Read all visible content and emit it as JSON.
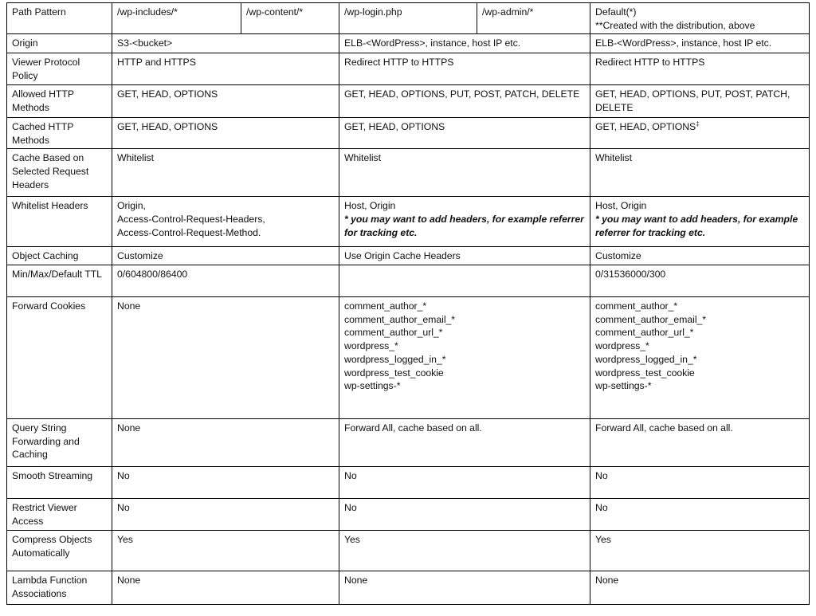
{
  "document": {
    "type": "cloudfront-behaviors-comparison-table",
    "columns": {
      "label_header": "Path Pattern",
      "headers": [
        {
          "id": "wp-includes",
          "label": "/wp-includes/*"
        },
        {
          "id": "wp-content",
          "label": "/wp-content/*"
        },
        {
          "id": "wp-login",
          "label": "/wp-login.php"
        },
        {
          "id": "wp-admin",
          "label": "/wp-admin/*"
        },
        {
          "id": "default",
          "label": "Default(*)",
          "note": "**Created with the distribution, above"
        }
      ]
    },
    "rows": [
      {
        "label": "Origin",
        "group_static": [
          "S3-<bucket>"
        ],
        "group_login": [
          "ELB-<WordPress>, instance, host IP etc."
        ],
        "group_default": [
          "ELB-<WordPress>, instance, host IP etc."
        ]
      },
      {
        "label": "Viewer Protocol Policy",
        "group_static": [
          "HTTP and HTTPS"
        ],
        "group_login": [
          "Redirect HTTP to HTTPS"
        ],
        "group_default": [
          "Redirect HTTP to HTTPS"
        ]
      },
      {
        "label": "Allowed HTTP Methods",
        "group_static": [
          "GET, HEAD, OPTIONS"
        ],
        "group_login": [
          "GET, HEAD, OPTIONS, PUT, POST, PATCH, DELETE"
        ],
        "group_default": [
          "GET, HEAD, OPTIONS, PUT, POST, PATCH, DELETE"
        ]
      },
      {
        "label": "Cached HTTP Methods",
        "group_static": [
          "GET, HEAD, OPTIONS"
        ],
        "group_login": [
          "GET, HEAD, OPTIONS"
        ],
        "group_default": [
          "GET, HEAD, OPTIONS"
        ],
        "group_default_superscript": "‡"
      },
      {
        "label": "Cache Based on Selected Request Headers",
        "group_static": [
          "Whitelist"
        ],
        "group_login": [
          "Whitelist"
        ],
        "group_default": [
          "Whitelist"
        ]
      },
      {
        "label": "Whitelist Headers",
        "group_static": [
          "Origin,",
          "Access-Control-Request-Headers,",
          "Access-Control-Request-Method."
        ],
        "group_login": [
          "Host, Origin"
        ],
        "group_login_italic": [
          "* you may want to add headers, for example referrer for tracking etc."
        ],
        "group_default": [
          "Host, Origin"
        ],
        "group_default_italic": [
          "* you may want to add headers, for example referrer for tracking etc."
        ]
      },
      {
        "label": "Object Caching",
        "group_static": [
          "Customize"
        ],
        "group_login": [
          "Use Origin Cache Headers"
        ],
        "group_default": [
          "Customize"
        ]
      },
      {
        "label": "Min/Max/Default TTL",
        "group_static": [
          "0/604800/86400"
        ],
        "group_login": [
          ""
        ],
        "group_default": [
          "0/31536000/300"
        ]
      },
      {
        "label": "Forward Cookies",
        "group_static": [
          "None"
        ],
        "group_login": [
          "comment_author_*",
          "comment_author_email_*",
          "comment_author_url_*",
          "wordpress_*",
          "wordpress_logged_in_*",
          "wordpress_test_cookie",
          "wp-settings-*"
        ],
        "group_default": [
          "comment_author_*",
          "comment_author_email_*",
          "comment_author_url_*",
          "wordpress_*",
          "wordpress_logged_in_*",
          "wordpress_test_cookie",
          "wp-settings-*"
        ]
      },
      {
        "label": "Query String Forwarding and Caching",
        "group_static": [
          "None"
        ],
        "group_login": [
          "Forward All, cache based on all."
        ],
        "group_default": [
          "Forward All, cache based on all."
        ]
      },
      {
        "label": "Smooth Streaming",
        "group_static": [
          "No"
        ],
        "group_login": [
          "No"
        ],
        "group_default": [
          "No"
        ]
      },
      {
        "label": "Restrict Viewer Access",
        "group_static": [
          "No"
        ],
        "group_login": [
          "No"
        ],
        "group_default": [
          "No"
        ]
      },
      {
        "label": "Compress Objects Automatically",
        "group_static": [
          "Yes"
        ],
        "group_login": [
          "Yes"
        ],
        "group_default": [
          "Yes"
        ]
      },
      {
        "label": "Lambda Function Associations",
        "group_static": [
          "None"
        ],
        "group_login": [
          "None"
        ],
        "group_default": [
          "None"
        ]
      }
    ],
    "colors": {
      "border": "#000000",
      "text": "#111111",
      "background": "#ffffff"
    }
  }
}
